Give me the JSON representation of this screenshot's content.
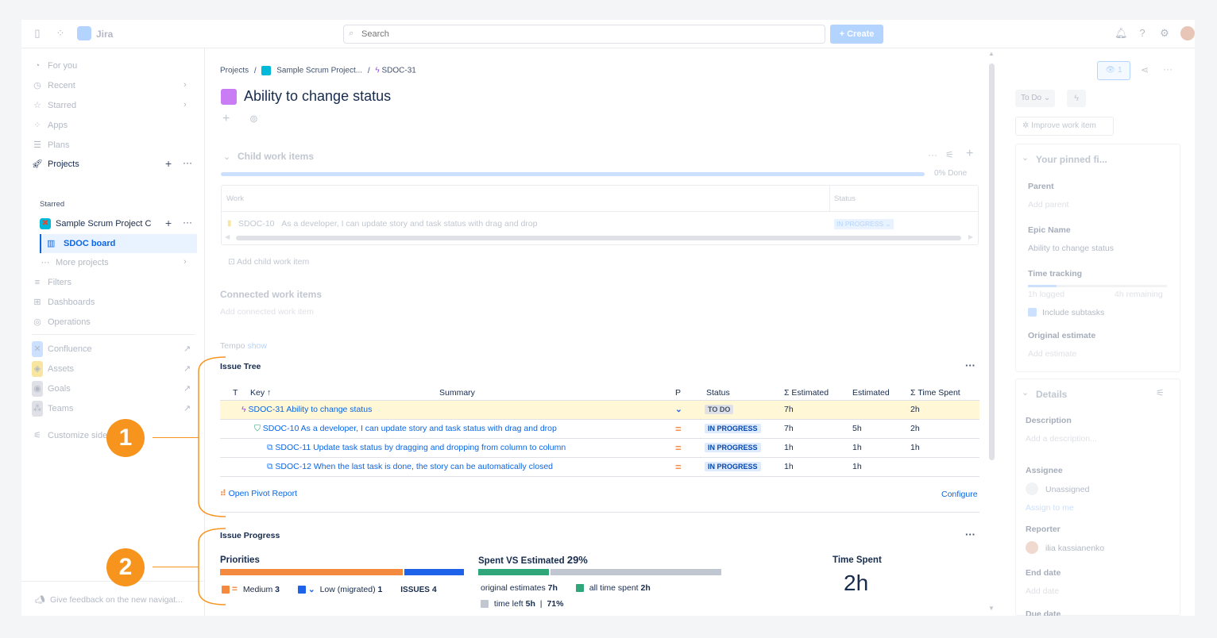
{
  "topbar": {
    "app_name": "Jira",
    "search_placeholder": "Search",
    "create_label": "Create"
  },
  "sidebar": {
    "for_you": "For you",
    "recent": "Recent",
    "starred": "Starred",
    "apps": "Apps",
    "plans": "Plans",
    "projects": "Projects",
    "starred_header": "Starred",
    "project_name": "Sample Scrum Project C",
    "board_name": "SDOC board",
    "more_projects": "More projects",
    "filters": "Filters",
    "dashboards": "Dashboards",
    "operations": "Operations",
    "confluence": "Confluence",
    "assets": "Assets",
    "goals": "Goals",
    "teams": "Teams",
    "customize": "Customize sidebar",
    "feedback": "Give feedback on the new navigat..."
  },
  "breadcrumb": {
    "projects": "Projects",
    "sep": "/",
    "project": "Sample Scrum Project...",
    "issue": "SDOC-31"
  },
  "issue": {
    "title": "Ability to change status"
  },
  "child_items": {
    "title": "Child work items",
    "done": "0% Done",
    "col_work": "Work",
    "col_status": "Status",
    "row_key": "SDOC-10",
    "row_summary": "As a developer, I can update story and task status with drag and drop",
    "row_status": "IN PROGRESS",
    "add_child": "Add child work item"
  },
  "connected": {
    "title": "Connected work items",
    "add": "Add connected work item"
  },
  "tempo": {
    "label": "Tempo",
    "show": "show"
  },
  "issue_tree": {
    "title": "Issue Tree",
    "headers": {
      "t": "T",
      "key": "Key ↑",
      "summary": "Summary",
      "p": "P",
      "status": "Status",
      "sum_estimated": "Σ Estimated",
      "estimated": "Estimated",
      "sum_time_spent": "Σ Time Spent"
    },
    "rows": [
      {
        "text": "SDOC-31 Ability to change status",
        "status": "TO DO",
        "sum_est": "7h",
        "est": "",
        "spent": "2h"
      },
      {
        "text": "SDOC-10 As a developer, I can update story and task status with drag and drop",
        "status": "IN PROGRESS",
        "sum_est": "7h",
        "est": "5h",
        "spent": "2h"
      },
      {
        "text": "SDOC-11 Update task status by dragging and dropping from column to column",
        "status": "IN PROGRESS",
        "sum_est": "1h",
        "est": "1h",
        "spent": "1h"
      },
      {
        "text": "SDOC-12 When the last task is done, the story can be automatically closed",
        "status": "IN PROGRESS",
        "sum_est": "1h",
        "est": "1h",
        "spent": ""
      }
    ],
    "pivot": "Open Pivot Report",
    "configure": "Configure"
  },
  "issue_progress": {
    "title": "Issue Progress",
    "priorities_title": "Priorities",
    "medium_label": "Medium",
    "medium_count": "3",
    "low_label": "Low (migrated)",
    "low_count": "1",
    "issues_label": "ISSUES",
    "issues_count": "4",
    "medium_fraction": 0.75,
    "spent_title": "Spent VS Estimated",
    "spent_pct": "29%",
    "spent_fraction": 0.29,
    "orig_est_label": "original estimates",
    "orig_est_value": "7h",
    "all_time_label": "all time spent",
    "all_time_value": "2h",
    "time_left_label": "time left",
    "time_left_value": "5h",
    "time_left_sep": "|",
    "time_left_pct": "71%",
    "time_spent_title": "Time Spent",
    "time_spent_value": "2h"
  },
  "right_panel": {
    "watch_count": "1",
    "status": "To Do",
    "improve": "Improve work item",
    "pinned": "Your pinned fi...",
    "parent_label": "Parent",
    "parent_value": "Add parent",
    "epic_label": "Epic Name",
    "epic_value": "Ability to change status",
    "time_tracking_label": "Time tracking",
    "logged": "1h logged",
    "remaining": "4h remaining",
    "include_subtasks": "Include subtasks",
    "orig_est_label": "Original estimate",
    "orig_est_value": "Add estimate",
    "details": "Details",
    "description_label": "Description",
    "description_value": "Add a description...",
    "assignee_label": "Assignee",
    "assignee_value": "Unassigned",
    "assign_to_me": "Assign to me",
    "reporter_label": "Reporter",
    "reporter_value": "ilia kassianenko",
    "end_date_label": "End date",
    "end_date_value": "Add date",
    "due_date_label": "Due date"
  },
  "callouts": {
    "one": "1",
    "two": "2"
  },
  "colors": {
    "medium": "#f38a3f",
    "low": "#1d62e8",
    "spent": "#2fa77a",
    "remaining": "#c1c7d0",
    "callout": "#f7941d"
  }
}
